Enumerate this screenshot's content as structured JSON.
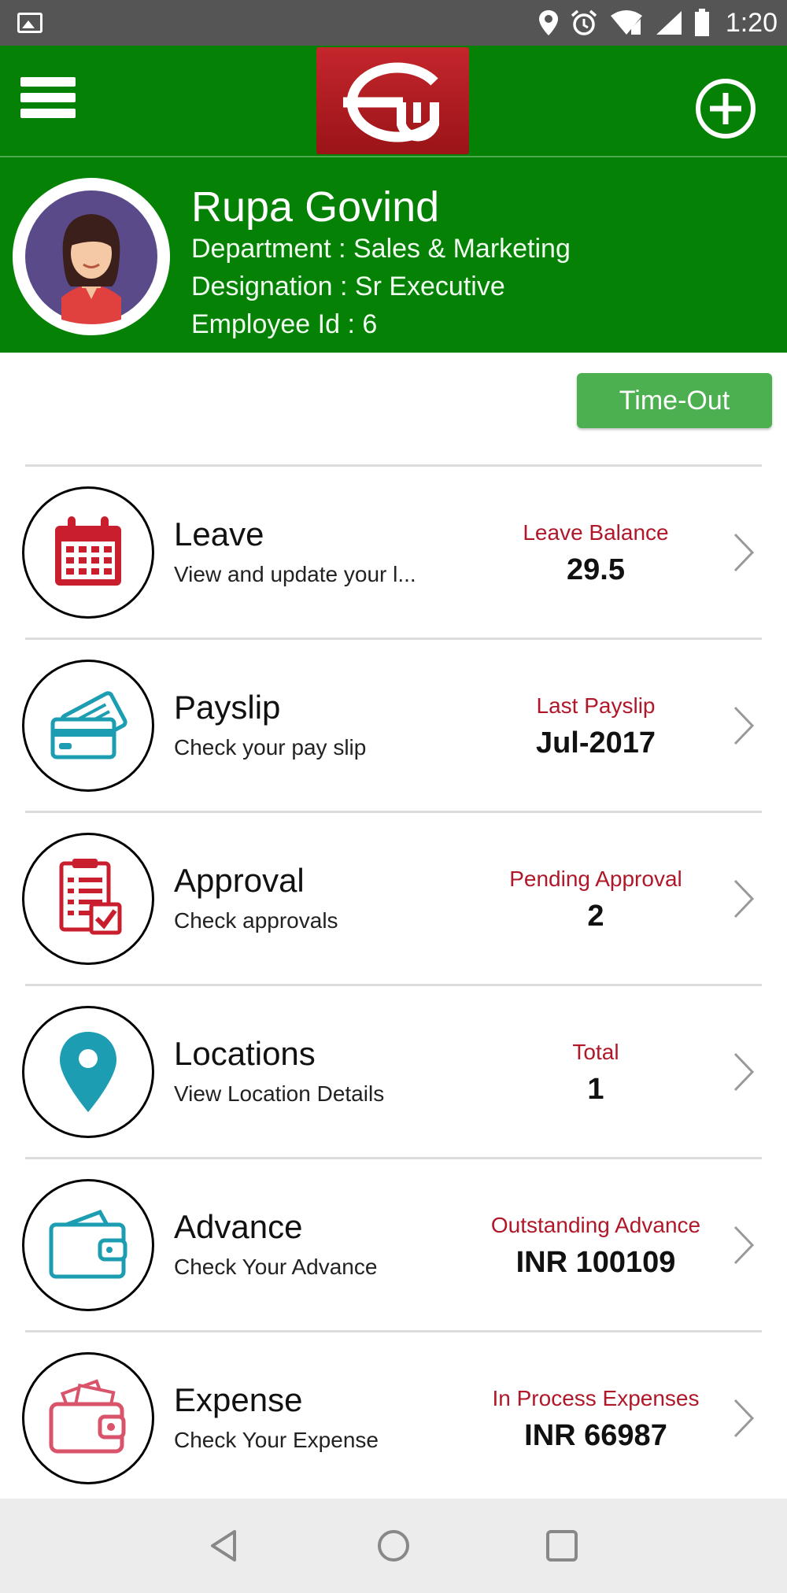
{
  "status_bar": {
    "time": "1:20",
    "icons": [
      "gallery-icon",
      "location-icon",
      "alarm-icon",
      "wifi-icon",
      "signal-icon",
      "battery-icon"
    ]
  },
  "app_bar": {
    "menu_icon": "hamburger-menu-icon",
    "logo": "ew-logo",
    "add_icon": "add-circle-icon",
    "color": "#058205"
  },
  "profile": {
    "name": "Rupa Govind",
    "department": "Department : Sales & Marketing",
    "designation": "Designation : Sr Executive",
    "employee_id": "Employee Id : 6"
  },
  "timeout_button": {
    "label": "Time-Out",
    "color": "#4caf50"
  },
  "items": [
    {
      "title": "Leave",
      "subtitle": "View and update your l...",
      "metric_label": "Leave Balance",
      "metric_value": "29.5",
      "icon": "calendar-icon",
      "color": "#c81e2d"
    },
    {
      "title": "Payslip",
      "subtitle": "Check your pay slip",
      "metric_label": "Last Payslip",
      "metric_value": "Jul-2017",
      "icon": "credit-card-icon",
      "color": "#1c9db2"
    },
    {
      "title": "Approval",
      "subtitle": "Check approvals",
      "metric_label": "Pending Approval",
      "metric_value": "2",
      "icon": "checklist-icon",
      "color": "#c81e2d"
    },
    {
      "title": "Locations",
      "subtitle": "View Location Details",
      "metric_label": "Total",
      "metric_value": "1",
      "icon": "map-pin-icon",
      "color": "#1c9db2"
    },
    {
      "title": "Advance",
      "subtitle": "Check Your Advance",
      "metric_label": "Outstanding Advance",
      "metric_value": "INR 100109",
      "icon": "wallet-icon",
      "color": "#1c9db2"
    },
    {
      "title": "Expense",
      "subtitle": "Check Your Expense",
      "metric_label": "In Process Expenses",
      "metric_value": "INR 66987",
      "icon": "wallet-cash-icon",
      "color": "#d9536a"
    }
  ],
  "accent_red": "#b0182a",
  "nav_bar": {
    "icons": [
      "back-icon",
      "home-icon",
      "recents-icon"
    ]
  }
}
